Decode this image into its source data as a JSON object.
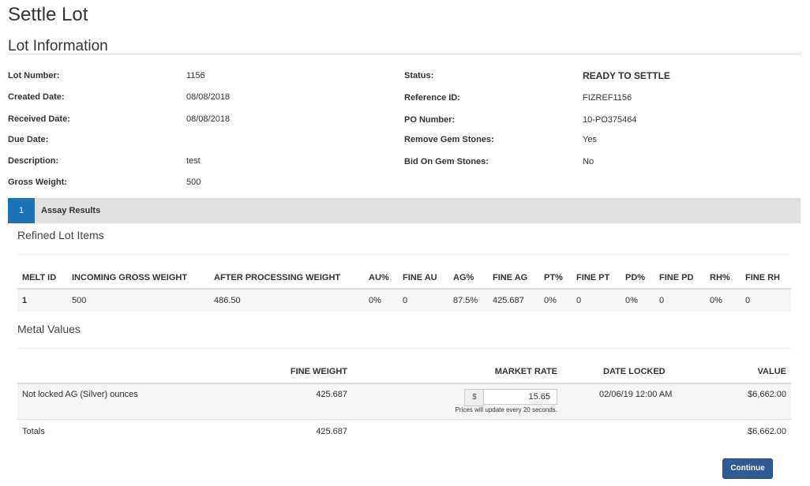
{
  "page_title": "Settle Lot",
  "lot_info": {
    "section_title": "Lot Information",
    "left": [
      {
        "label": "Lot Number:",
        "value": "1156"
      },
      {
        "label": "Created Date:",
        "value": "08/08/2018"
      },
      {
        "label": "Received Date:",
        "value": "08/08/2018"
      },
      {
        "label": "Due Date:",
        "value": ""
      },
      {
        "label": "Description:",
        "value": "test"
      },
      {
        "label": "Gross Weight:",
        "value": "500"
      }
    ],
    "right": [
      {
        "label": "Status:",
        "value": "READY TO SETTLE"
      },
      {
        "label": "Reference ID:",
        "value": "FIZREF1156"
      },
      {
        "label": "PO Number:",
        "value": "10-PO375464"
      },
      {
        "label": "Remove Gem Stones:",
        "value": "Yes"
      },
      {
        "label": "Bid On Gem Stones:",
        "value": "No"
      }
    ]
  },
  "tab": {
    "number": "1",
    "label": "Assay Results"
  },
  "refined": {
    "title": "Refined Lot Items",
    "headers": [
      "MELT ID",
      "INCOMING GROSS WEIGHT",
      "AFTER PROCESSING WEIGHT",
      "AU%",
      "FINE AU",
      "AG%",
      "FINE AG",
      "PT%",
      "FINE PT",
      "PD%",
      "FINE PD",
      "RH%",
      "FINE RH"
    ],
    "rows": [
      [
        "1",
        "500",
        "486.50",
        "0%",
        "0",
        "87.5%",
        "425.687",
        "0%",
        "0",
        "0%",
        "0",
        "0%",
        "0"
      ]
    ]
  },
  "metal": {
    "title": "Metal Values",
    "headers": {
      "fine_weight": "FINE WEIGHT",
      "market_rate": "MARKET RATE",
      "date_locked": "DATE LOCKED",
      "value": "VALUE"
    },
    "row": {
      "name": "Not locked AG (Silver) ounces",
      "fine_weight": "425.687",
      "currency": "$",
      "market_rate": "15.65",
      "hint": "Prices will update every 20 seconds.",
      "date_locked": "02/06/19 12:00 AM",
      "value": "$6,662.00"
    },
    "totals": {
      "label": "Totals",
      "fine_weight": "425.687",
      "value": "$6,662.00"
    }
  },
  "continue_label": "Continue"
}
